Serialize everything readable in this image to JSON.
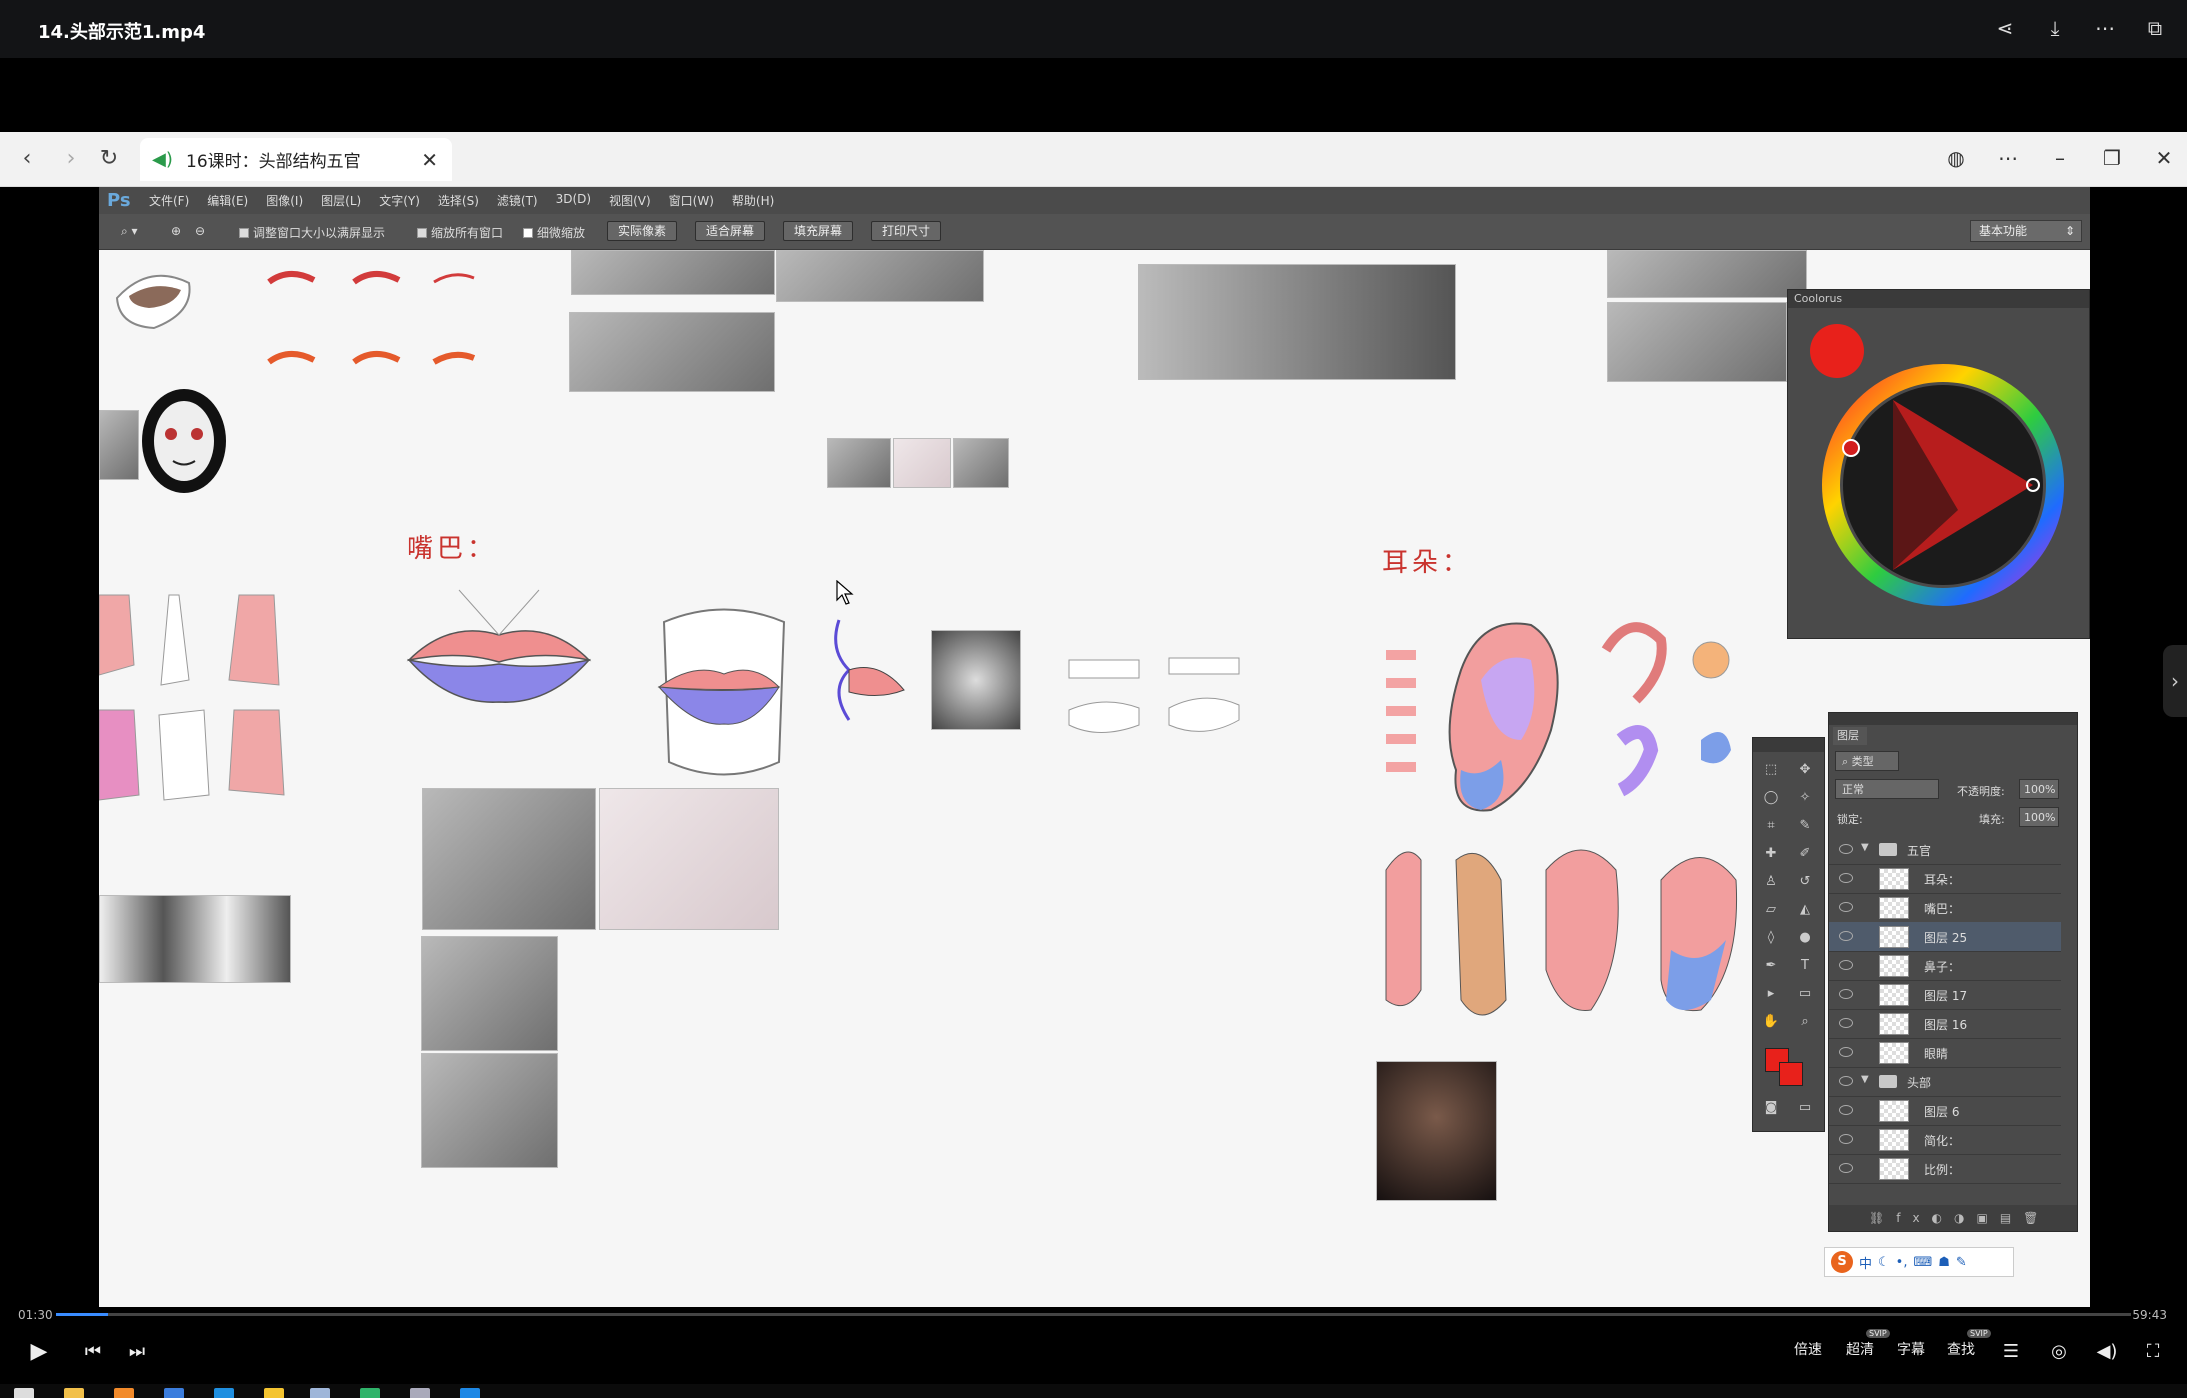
{
  "player": {
    "title": "14.头部示范1.mp4",
    "icons": [
      "share-icon",
      "download-icon",
      "more-icon",
      "pip-icon"
    ],
    "time_current": "01:30",
    "time_total": "59:43",
    "progress_fraction": 0.025,
    "controls": {
      "speed": "倍速",
      "quality": "超清",
      "quality_badge": "SVIP",
      "subtitle": "字幕",
      "search": "查找",
      "search_badge": "SVIP"
    }
  },
  "browser": {
    "tab_title": "16课时：头部结构五官"
  },
  "photoshop": {
    "logo": "Ps",
    "menu": [
      "文件(F)",
      "编辑(E)",
      "图像(I)",
      "图层(L)",
      "文字(Y)",
      "选择(S)",
      "滤镜(T)",
      "3D(D)",
      "视图(V)",
      "窗口(W)",
      "帮助(H)"
    ],
    "options": {
      "resize_windows": "调整窗口大小以满屏显示",
      "zoom_all": "缩放所有窗口",
      "scrubby_zoom": "细微缩放",
      "actual_pixels": "实际像素",
      "fit_screen": "适合屏幕",
      "fill_screen": "填充屏幕",
      "print_size": "打印尺寸",
      "workspace": "基本功能"
    },
    "canvas_labels": {
      "mouth": "嘴巴：",
      "ear": "耳朵："
    },
    "coolorus": {
      "title": "Coolorus",
      "accent": "#e8211b"
    },
    "layers": {
      "tab": "图层",
      "kind": "类型",
      "blend": "正常",
      "opacity_label": "不透明度:",
      "opacity": "100%",
      "lock_label": "锁定:",
      "fill_label": "填充:",
      "fill": "100%",
      "rows": [
        {
          "name": "五官",
          "type": "group"
        },
        {
          "name": "耳朵：",
          "type": "layer"
        },
        {
          "name": "嘴巴：",
          "type": "layer"
        },
        {
          "name": "图层 25",
          "type": "layer",
          "selected": true
        },
        {
          "name": "鼻子：",
          "type": "layer"
        },
        {
          "name": "图层 17",
          "type": "layer"
        },
        {
          "name": "图层 16",
          "type": "layer"
        },
        {
          "name": "眼睛",
          "type": "layer"
        },
        {
          "name": "头部",
          "type": "group"
        },
        {
          "name": "图层 6",
          "type": "layer"
        },
        {
          "name": "简化：",
          "type": "layer"
        },
        {
          "name": "比例：",
          "type": "layer"
        }
      ]
    },
    "ime": "中"
  }
}
